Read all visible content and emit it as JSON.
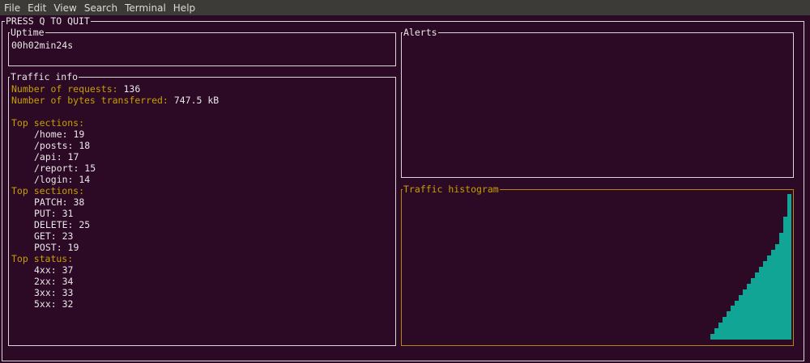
{
  "menu": [
    "File",
    "Edit",
    "View",
    "Search",
    "Terminal",
    "Help"
  ],
  "outer_title": "PRESS Q TO QUIT",
  "uptime": {
    "title": "Uptime",
    "value": "00h02min24s"
  },
  "alerts": {
    "title": "Alerts"
  },
  "traffic": {
    "title": "Traffic info",
    "requests_label": "Number of requests:",
    "requests_value": "136",
    "bytes_label": "Number of bytes transferred:",
    "bytes_value": "747.5 kB",
    "sections_title": "Top sections:",
    "sections": [
      {
        "text": "/home: 19"
      },
      {
        "text": "/posts: 18"
      },
      {
        "text": "/api: 17"
      },
      {
        "text": "/report: 15"
      },
      {
        "text": "/login: 14"
      }
    ],
    "methods_title": "Top sections:",
    "methods": [
      {
        "text": "PATCH: 38"
      },
      {
        "text": "PUT: 31"
      },
      {
        "text": "DELETE: 25"
      },
      {
        "text": "GET: 23"
      },
      {
        "text": "POST: 19"
      }
    ],
    "status_title": "Top status:",
    "status": [
      {
        "text": "4xx: 37"
      },
      {
        "text": "2xx: 34"
      },
      {
        "text": "3xx: 33"
      },
      {
        "text": "5xx: 32"
      }
    ]
  },
  "histogram": {
    "title": "Traffic histogram",
    "bar_color": "#11a595",
    "chart_data": {
      "type": "bar",
      "values": [
        1,
        2,
        3,
        4,
        5,
        6,
        7,
        8,
        9,
        10,
        11,
        12,
        13,
        14,
        15,
        16,
        17,
        19,
        22,
        26
      ],
      "ylim": [
        0,
        26
      ]
    }
  }
}
